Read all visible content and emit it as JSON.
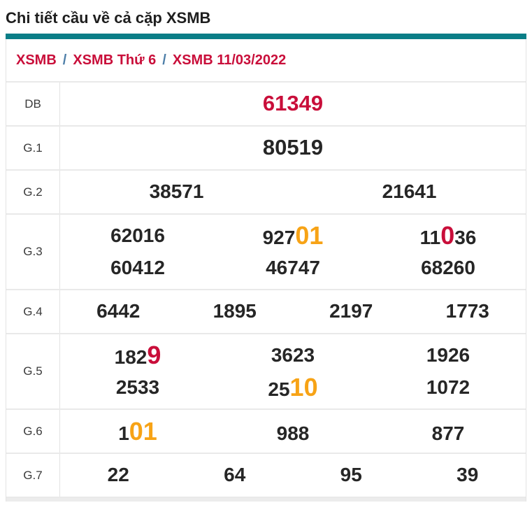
{
  "page": {
    "title": "Chi tiết cầu về cả cặp XSMB"
  },
  "breadcrumb": {
    "separator": "/",
    "items": [
      {
        "label": "XSMB"
      },
      {
        "label": "XSMB Thứ 6"
      },
      {
        "label": "XSMB 11/03/2022"
      }
    ]
  },
  "colors": {
    "accent_teal": "#0a7e87",
    "crimson": "#c90e3a",
    "orange": "#f7a316",
    "number_text": "#262626",
    "label_text": "#3a3a3a",
    "breadcrumb_separator": "#4d7ea8"
  },
  "table": {
    "rows": [
      {
        "id": "db",
        "label": "DB",
        "size": "big",
        "lines": [
          [
            [
              {
                "t": "61349",
                "s": "red"
              }
            ]
          ]
        ]
      },
      {
        "id": "g1",
        "label": "G.1",
        "size": "big",
        "lines": [
          [
            [
              {
                "t": "80519"
              }
            ]
          ]
        ]
      },
      {
        "id": "g2",
        "label": "G.2",
        "lines": [
          [
            [
              {
                "t": "38571"
              }
            ],
            [
              {
                "t": "21641"
              }
            ]
          ]
        ]
      },
      {
        "id": "g3",
        "label": "G.3",
        "lines": [
          [
            [
              {
                "t": "62016"
              }
            ],
            [
              {
                "t": "927"
              },
              {
                "t": "01",
                "s": "hl-orange"
              }
            ],
            [
              {
                "t": "11"
              },
              {
                "t": "0",
                "s": "hl-red"
              },
              {
                "t": "36"
              }
            ]
          ],
          [
            [
              {
                "t": "60412"
              }
            ],
            [
              {
                "t": "46747"
              }
            ],
            [
              {
                "t": "68260"
              }
            ]
          ]
        ]
      },
      {
        "id": "g4",
        "label": "G.4",
        "lines": [
          [
            [
              {
                "t": "6442"
              }
            ],
            [
              {
                "t": "1895"
              }
            ],
            [
              {
                "t": "2197"
              }
            ],
            [
              {
                "t": "1773"
              }
            ]
          ]
        ]
      },
      {
        "id": "g5",
        "label": "G.5",
        "lines": [
          [
            [
              {
                "t": "182"
              },
              {
                "t": "9",
                "s": "hl-red"
              }
            ],
            [
              {
                "t": "3623"
              }
            ],
            [
              {
                "t": "1926"
              }
            ]
          ],
          [
            [
              {
                "t": "2533"
              }
            ],
            [
              {
                "t": "25"
              },
              {
                "t": "10",
                "s": "hl-orange"
              }
            ],
            [
              {
                "t": "1072"
              }
            ]
          ]
        ]
      },
      {
        "id": "g6",
        "label": "G.6",
        "lines": [
          [
            [
              {
                "t": "1"
              },
              {
                "t": "01",
                "s": "hl-orange"
              }
            ],
            [
              {
                "t": "988"
              }
            ],
            [
              {
                "t": "877"
              }
            ]
          ]
        ]
      },
      {
        "id": "g7",
        "label": "G.7",
        "lines": [
          [
            [
              {
                "t": "22"
              }
            ],
            [
              {
                "t": "64"
              }
            ],
            [
              {
                "t": "95"
              }
            ],
            [
              {
                "t": "39"
              }
            ]
          ]
        ]
      }
    ]
  }
}
